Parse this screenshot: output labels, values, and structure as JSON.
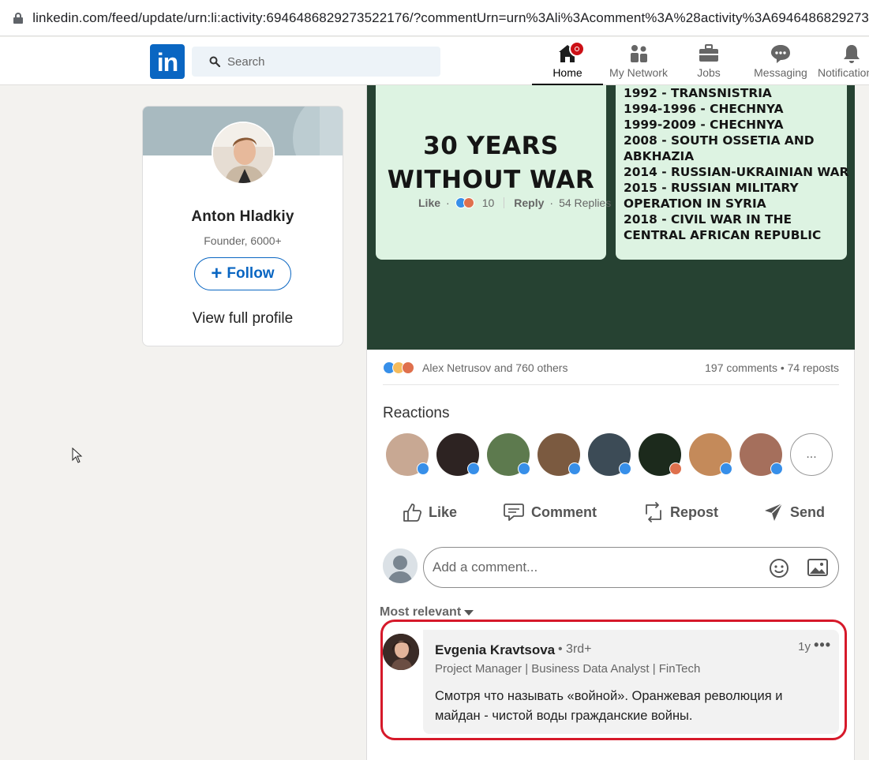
{
  "browser": {
    "url": "linkedin.com/feed/update/urn:li:activity:6946486829273522176/?commentUrn=urn%3Ali%3Acomment%3A%28activity%3A6946486829273"
  },
  "nav": {
    "logo_text": "in",
    "search_placeholder": "Search",
    "items": [
      {
        "label": "Home",
        "icon": "home-icon",
        "active": true
      },
      {
        "label": "My Network",
        "icon": "network-icon"
      },
      {
        "label": "Jobs",
        "icon": "briefcase-icon"
      },
      {
        "label": "Messaging",
        "icon": "messaging-icon"
      },
      {
        "label": "Notifications",
        "icon": "bell-icon"
      }
    ]
  },
  "profile": {
    "name": "Anton Hladkiy",
    "title": "Founder, 6000+",
    "follow_label": "Follow",
    "view_full": "View full profile"
  },
  "post": {
    "image": {
      "headline_line1": "30 YEARS",
      "headline_line2": "WITHOUT WAR",
      "wars": [
        "1992 - TRANSNISTRIA",
        "1994-1996 - CHECHNYA",
        "1999-2009 - CHECHNYA",
        "2008 - SOUTH OSSETIA AND",
        "ABKHAZIA",
        "2014 - RUSSIAN-UKRAINIAN WAR",
        "2015 - RUSSIAN MILITARY",
        "OPERATION IN SYRIA",
        "2018 - CIVIL WAR IN THE",
        "CENTRAL AFRICAN REPUBLIC"
      ]
    },
    "social_names": "Alex Netrusov and 760 others",
    "social_counts": "197 comments • 74 reposts",
    "reactions_title": "Reactions",
    "more_reactors": "...",
    "actions": {
      "like": "Like",
      "comment": "Comment",
      "repost": "Repost",
      "send": "Send"
    },
    "comment_placeholder": "Add a comment...",
    "sort_label": "Most relevant"
  },
  "comment": {
    "author": "Evgenia Kravtsova",
    "degree": "• 3rd+",
    "time": "1y",
    "more": "•••",
    "headline": "Project Manager | Business Data Analyst | FinTech",
    "text": "Смотря что называть «войной». Оранжевая революция и майдан - чистой воды гражданские войны.",
    "like_label": "Like",
    "reaction_count": "10",
    "reply_label": "Reply",
    "replies": "54 Replies"
  },
  "colors": {
    "brand": "#0a66c2",
    "highlight": "#d6192a",
    "image_bg": "#264232",
    "panel": "#ddf3e2"
  }
}
